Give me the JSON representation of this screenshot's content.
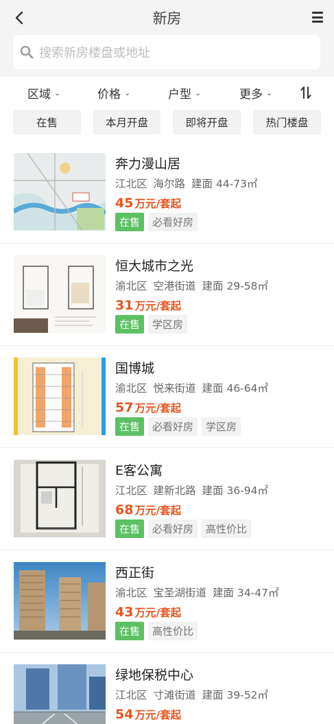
{
  "header": {
    "title": "新房",
    "search_placeholder": "搜索新房楼盘或地址"
  },
  "filters": [
    "区域",
    "价格",
    "户型",
    "更多"
  ],
  "quick_filters": [
    "在售",
    "本月开盘",
    "即将开盘",
    "热门楼盘"
  ],
  "listings": [
    {
      "name": "奔力漫山居",
      "district": "江北区",
      "street": "海尔路",
      "area": "建面 44-73㎡",
      "price": "45",
      "price_unit": "万元/套起",
      "status": "在售",
      "tags": [
        "必看好房"
      ]
    },
    {
      "name": "恒大城市之光",
      "district": "渝北区",
      "street": "空港街道",
      "area": "建面 29-58㎡",
      "price": "31",
      "price_unit": "万元/套起",
      "status": "在售",
      "tags": [
        "学区房"
      ]
    },
    {
      "name": "国博城",
      "district": "渝北区",
      "street": "悦来街道",
      "area": "建面 46-64㎡",
      "price": "57",
      "price_unit": "万元/套起",
      "status": "在售",
      "tags": [
        "必看好房",
        "学区房"
      ]
    },
    {
      "name": "E客公寓",
      "district": "江北区",
      "street": "建新北路",
      "area": "建面 36-94㎡",
      "price": "68",
      "price_unit": "万元/套起",
      "status": "在售",
      "tags": [
        "必看好房",
        "高性价比"
      ]
    },
    {
      "name": "西正街",
      "district": "渝北区",
      "street": "宝圣湖街道",
      "area": "建面 34-47㎡",
      "price": "43",
      "price_unit": "万元/套起",
      "status": "在售",
      "tags": [
        "高性价比"
      ]
    },
    {
      "name": "绿地保税中心",
      "district": "江北区",
      "street": "寸滩街道",
      "area": "建面 39-52㎡",
      "price": "54",
      "price_unit": "万元/套起",
      "status": "",
      "tags": []
    }
  ],
  "colors": {
    "price": "#e8541e",
    "on_sale": "#5bc163",
    "header_bg": "#f4f4f4"
  },
  "icons": [
    "back-arrow-icon",
    "menu-icon",
    "search-icon",
    "chevron-down-icon",
    "sort-icon"
  ]
}
